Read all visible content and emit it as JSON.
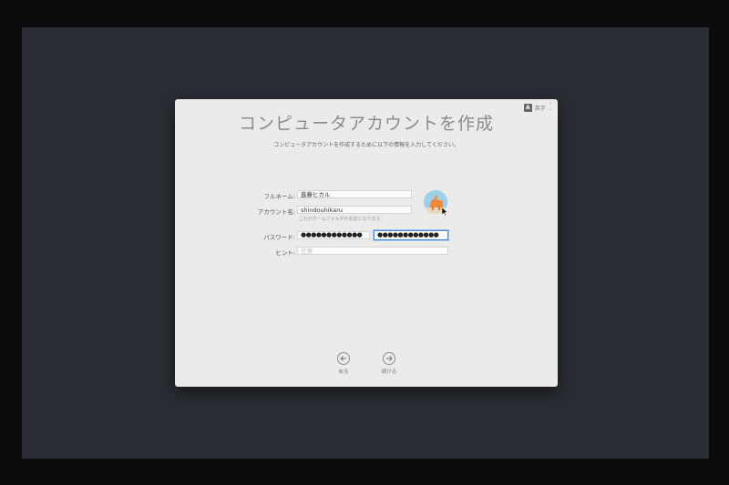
{
  "input_menu": {
    "badge": "A",
    "label": "英字"
  },
  "header": {
    "title": "コンピュータアカウントを作成",
    "subtitle": "コンピュータアカウントを作成するために以下の情報を入力してください。"
  },
  "form": {
    "full_name": {
      "label": "フルネーム:",
      "value": "進藤ヒカル"
    },
    "account_name": {
      "label": "アカウント名:",
      "value": "shindouhikaru",
      "helper": "これがホームフォルダの名前になります。"
    },
    "password": {
      "label": "パスワード:",
      "value": "●●●●●●●●●●●●",
      "verify_value": "●●●●●●●●●●●●"
    },
    "hint": {
      "label": "ヒント:",
      "placeholder": "任意"
    }
  },
  "nav": {
    "back_label": "戻る",
    "continue_label": "続ける"
  },
  "colors": {
    "focus_ring": "#4d8ee0",
    "dialog_bg": "#ecebe9",
    "screen_bg": "#2a2d33"
  }
}
